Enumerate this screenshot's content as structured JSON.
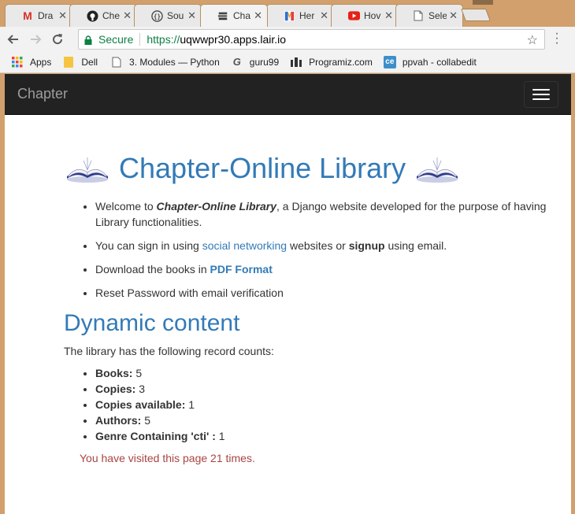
{
  "browser": {
    "tabs": [
      {
        "title": "Dra",
        "icon": "gmail-icon",
        "active": false
      },
      {
        "title": "Che",
        "icon": "github-icon",
        "active": false
      },
      {
        "title": "Sou",
        "icon": "code-icon",
        "active": false
      },
      {
        "title": "Cha",
        "icon": "book-stack-icon",
        "active": true
      },
      {
        "title": "Her",
        "icon": "heroku-m-icon",
        "active": false
      },
      {
        "title": "Hov",
        "icon": "youtube-icon",
        "active": false
      },
      {
        "title": "Sele",
        "icon": "document-icon",
        "active": false
      }
    ],
    "close_glyph": "✕",
    "address": {
      "secure_label": "Secure",
      "scheme": "https://",
      "host": "uqwwpr30.apps.lair.io"
    },
    "bookmarks": [
      {
        "label": "Apps",
        "icon": "apps-grid-icon"
      },
      {
        "label": "Dell",
        "icon": "folder-icon"
      },
      {
        "label": "3. Modules — Python",
        "icon": "page-icon"
      },
      {
        "label": "guru99",
        "icon": "guru99-icon"
      },
      {
        "label": "Programiz.com",
        "icon": "programiz-icon"
      },
      {
        "label": "ppvah - collabedit",
        "icon": "collabedit-icon"
      }
    ]
  },
  "navbar": {
    "brand": "Chapter"
  },
  "main": {
    "title": "Chapter-Online Library",
    "features": {
      "welcome_pre": "Welcome to ",
      "welcome_em": "Chapter-Online Library",
      "welcome_post": ", a Django website developed for the purpose of having Library functionalities.",
      "signin_pre": "You can sign in using ",
      "signin_link": "social networking",
      "signin_mid": " websites or ",
      "signin_bold": "signup",
      "signin_post": " using email.",
      "download_pre": "Download the books in ",
      "download_link": "PDF Format",
      "reset": "Reset Password with email verification"
    },
    "dynamic_heading": "Dynamic content",
    "intro": "The library has the following record counts:",
    "counts": [
      {
        "label": "Books:",
        "value": "5"
      },
      {
        "label": "Copies:",
        "value": "3"
      },
      {
        "label": "Copies available:",
        "value": "1"
      },
      {
        "label": "Authors:",
        "value": "5"
      },
      {
        "label": "Genre Containing 'cti' :",
        "value": "1"
      }
    ],
    "visits": "You have visited this page 21 times."
  },
  "colors": {
    "accent": "#337ab7",
    "navbar_bg": "#222222",
    "visits_text": "#a94442",
    "secure_green": "#0b8043"
  }
}
